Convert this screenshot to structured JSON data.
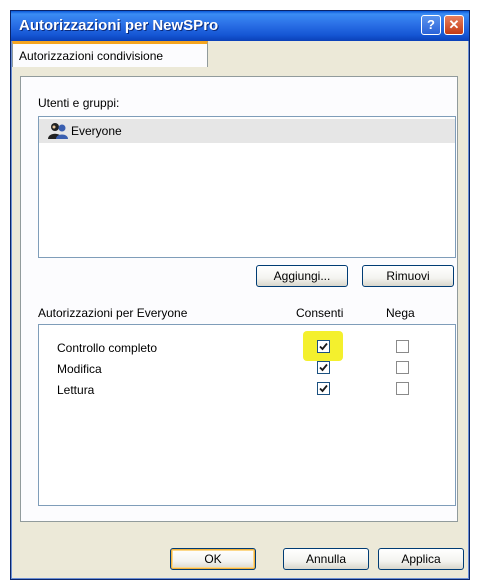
{
  "window": {
    "title": "Autorizzazioni per NewSPro"
  },
  "tabs": [
    {
      "label": "Autorizzazioni condivisione"
    }
  ],
  "users": {
    "label": "Utenti e gruppi:",
    "items": [
      {
        "name": "Everyone",
        "icon": "users-group-icon"
      }
    ]
  },
  "buttons": {
    "add": "Aggiungi...",
    "remove": "Rimuovi"
  },
  "permissions": {
    "label": "Autorizzazioni per Everyone",
    "col_allow": "Consenti",
    "col_deny": "Nega",
    "rows": [
      {
        "name": "Controllo completo",
        "allow": true,
        "deny": false
      },
      {
        "name": "Modifica",
        "allow": true,
        "deny": false
      },
      {
        "name": "Lettura",
        "allow": true,
        "deny": false
      }
    ]
  },
  "footer": {
    "ok": "OK",
    "cancel": "Annulla",
    "apply": "Applica"
  },
  "colors": {
    "highlight": "#f3ee16",
    "titlebar": "#2a6fe6",
    "tab_accent": "#f5a520"
  }
}
